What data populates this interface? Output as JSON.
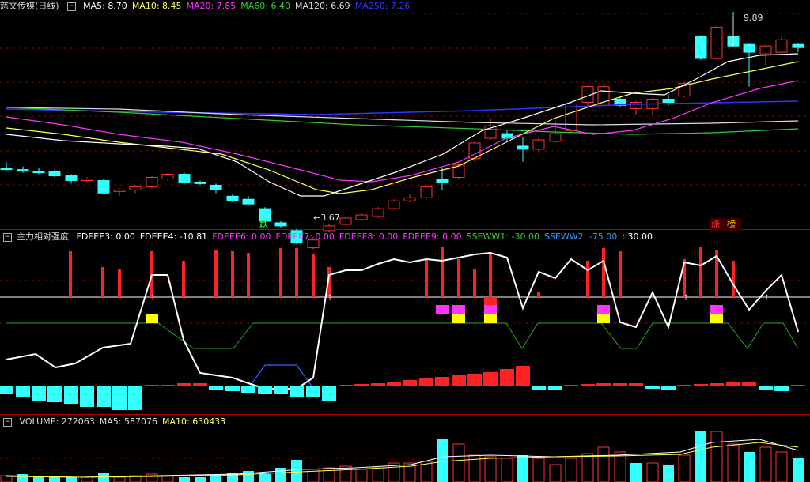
{
  "stock": {
    "name": "慈文传媒",
    "period": "(日线)"
  },
  "ma_legend": [
    {
      "label": "MA5:",
      "value": "8.70",
      "color": "#ffffff"
    },
    {
      "label": "MA10:",
      "value": "8.45",
      "color": "#ffff55"
    },
    {
      "label": "MA20:",
      "value": "7.85",
      "color": "#ff33ff"
    },
    {
      "label": "MA60:",
      "value": "6.40",
      "color": "#33cc33"
    },
    {
      "label": "MA120:",
      "value": "6.69",
      "color": "#dddddd"
    },
    {
      "label": "MA250:",
      "value": "7.26",
      "color": "#3333ff"
    }
  ],
  "price_annotations": {
    "high": "9.89",
    "low": "3.67"
  },
  "signals": {
    "down": "跌",
    "up": "涨",
    "limit": "榜"
  },
  "indicator": {
    "name": "主力相对强度",
    "items": [
      {
        "label": "FDEEE3:",
        "value": "0.00",
        "color": "#ffffff"
      },
      {
        "label": "FDEEE4:",
        "value": "-10.81",
        "color": "#ffffff"
      },
      {
        "label": "FDEEE6:",
        "value": "0.00",
        "color": "#ff33ff"
      },
      {
        "label": "FDEEE7:",
        "value": "0.00",
        "color": "#ff33ff"
      },
      {
        "label": "FDEEE8:",
        "value": "0.00",
        "color": "#ff33ff"
      },
      {
        "label": "FDEEE9:",
        "value": "0.00",
        "color": "#ff33ff"
      },
      {
        "label": "SSEWW1:",
        "value": "-30.00",
        "color": "#33cc33"
      },
      {
        "label": "SSEWW2:",
        "value": "-75.00",
        "color": "#3399ff"
      },
      {
        "label": ":",
        "value": "30.00",
        "color": "#ffffff"
      }
    ]
  },
  "volume": {
    "items": [
      {
        "label": "VOLUME:",
        "value": "272063",
        "color": "#dddddd"
      },
      {
        "label": "MA5:",
        "value": "587076",
        "color": "#dddddd"
      },
      {
        "label": "MA10:",
        "value": "630433",
        "color": "#ffff55"
      }
    ]
  },
  "colors": {
    "up": "#ff3333",
    "down": "#33ffff",
    "bg": "#000000",
    "grid": "#b00000"
  }
}
